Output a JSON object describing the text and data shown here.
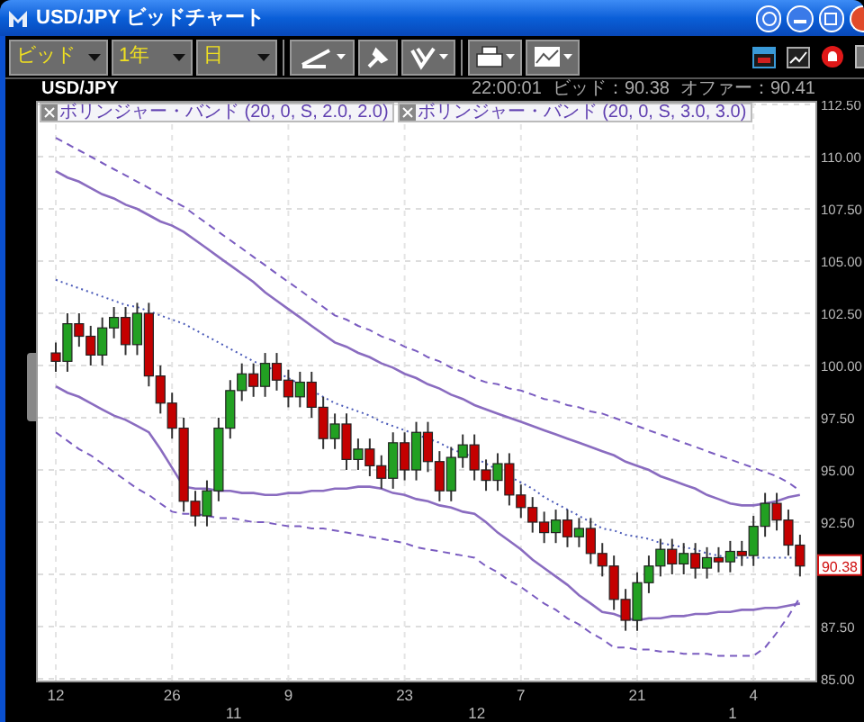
{
  "window": {
    "title": "USD/JPY ビッドチャート"
  },
  "toolbar": {
    "dropdowns": [
      {
        "value": "ビッド"
      },
      {
        "value": "1年"
      },
      {
        "value": "日"
      }
    ]
  },
  "chart": {
    "symbol": "USD/JPY",
    "time": "22:00:01",
    "bid": "ビッド：90.38",
    "offer": "オファー：90.41",
    "legends": [
      {
        "label": "ボリンジャー・バンド (20, 0, S, 2.0, 2.0)"
      },
      {
        "label": "ボリンジャー・バンド (20, 0, S, 3.0, 3.0)"
      }
    ],
    "price_tag": "90.38",
    "chart_data": {
      "type": "candlestick",
      "ylim": [
        85,
        112.5
      ],
      "grid": true,
      "yticks": [
        {
          "value": 85,
          "label": "85.00"
        },
        {
          "value": 87.5,
          "label": "87.50"
        },
        {
          "value": 92.5,
          "label": "92.50"
        },
        {
          "value": 95,
          "label": "95.00"
        },
        {
          "value": 97.5,
          "label": "97.50"
        },
        {
          "value": 100,
          "label": "100.00"
        },
        {
          "value": 102.5,
          "label": "102.50"
        },
        {
          "value": 105,
          "label": "105.00"
        },
        {
          "value": 107.5,
          "label": "107.50"
        },
        {
          "value": 110,
          "label": "110.00"
        },
        {
          "value": 112.5,
          "label": "112.50"
        }
      ],
      "categories": [
        "12",
        null,
        null,
        null,
        null,
        null,
        null,
        null,
        null,
        null,
        "26",
        null,
        null,
        null,
        null,
        null,
        null,
        null,
        null,
        null,
        "9",
        null,
        null,
        null,
        null,
        null,
        null,
        null,
        null,
        null,
        "23",
        null,
        null,
        null,
        null,
        null,
        null,
        null,
        null,
        null,
        "7",
        null,
        null,
        null,
        null,
        null,
        null,
        null,
        null,
        null,
        "21",
        null,
        null,
        null,
        null,
        null,
        null,
        null,
        null,
        null,
        "4",
        null,
        null,
        null,
        null
      ],
      "annotations": [
        "11",
        "12",
        "1"
      ],
      "ohlc": [
        [
          100.6,
          101.1,
          99.7,
          100.2
        ],
        [
          100.2,
          102.5,
          99.7,
          102.0
        ],
        [
          102.0,
          102.5,
          100.9,
          101.4
        ],
        [
          101.4,
          101.9,
          100.0,
          100.5
        ],
        [
          100.5,
          102.3,
          100.0,
          101.8
        ],
        [
          101.8,
          102.8,
          101.3,
          102.3
        ],
        [
          102.3,
          102.8,
          100.5,
          101.0
        ],
        [
          101.0,
          103.0,
          100.5,
          102.5
        ],
        [
          102.5,
          103.0,
          99.0,
          99.5
        ],
        [
          99.5,
          100.0,
          97.7,
          98.2
        ],
        [
          98.2,
          98.7,
          96.5,
          97.0
        ],
        [
          97.0,
          97.5,
          93.0,
          93.5
        ],
        [
          93.5,
          94.0,
          92.3,
          92.8
        ],
        [
          92.8,
          94.5,
          92.3,
          94.0
        ],
        [
          94.0,
          97.5,
          93.5,
          97.0
        ],
        [
          97.0,
          99.3,
          96.5,
          98.8
        ],
        [
          98.8,
          100.1,
          98.3,
          99.6
        ],
        [
          99.6,
          100.1,
          98.5,
          99.0
        ],
        [
          99.0,
          100.6,
          98.5,
          100.1
        ],
        [
          100.1,
          100.6,
          98.8,
          99.3
        ],
        [
          99.3,
          99.8,
          98.0,
          98.5
        ],
        [
          98.5,
          99.7,
          98.0,
          99.2
        ],
        [
          99.2,
          99.7,
          97.5,
          98.0
        ],
        [
          98.0,
          98.5,
          96.0,
          96.5
        ],
        [
          96.5,
          97.7,
          96.0,
          97.2
        ],
        [
          97.2,
          97.7,
          95.0,
          95.5
        ],
        [
          95.5,
          96.5,
          95.0,
          96.0
        ],
        [
          96.0,
          96.5,
          94.7,
          95.2
        ],
        [
          95.2,
          95.7,
          94.1,
          94.6
        ],
        [
          94.6,
          96.8,
          94.1,
          96.3
        ],
        [
          96.3,
          96.8,
          94.5,
          95.0
        ],
        [
          95.0,
          97.3,
          94.5,
          96.8
        ],
        [
          96.8,
          97.3,
          94.9,
          95.4
        ],
        [
          95.4,
          95.9,
          93.5,
          94.0
        ],
        [
          94.0,
          96.1,
          93.5,
          95.6
        ],
        [
          95.6,
          96.7,
          95.1,
          96.2
        ],
        [
          96.2,
          96.7,
          94.5,
          95.0
        ],
        [
          95.0,
          95.5,
          94.0,
          94.5
        ],
        [
          94.5,
          95.8,
          94.0,
          95.3
        ],
        [
          95.3,
          95.8,
          93.3,
          93.8
        ],
        [
          93.8,
          94.3,
          92.7,
          93.2
        ],
        [
          93.2,
          93.7,
          92.0,
          92.5
        ],
        [
          92.5,
          93.0,
          91.5,
          92.0
        ],
        [
          92.0,
          93.1,
          91.5,
          92.6
        ],
        [
          92.6,
          93.1,
          91.3,
          91.8
        ],
        [
          91.8,
          92.7,
          91.3,
          92.2
        ],
        [
          92.2,
          92.7,
          90.5,
          91.0
        ],
        [
          91.0,
          91.5,
          89.9,
          90.4
        ],
        [
          90.4,
          90.9,
          88.3,
          88.8
        ],
        [
          88.8,
          89.3,
          87.3,
          87.8
        ],
        [
          87.8,
          90.1,
          87.3,
          89.6
        ],
        [
          89.6,
          90.9,
          89.1,
          90.4
        ],
        [
          90.4,
          91.7,
          89.9,
          91.2
        ],
        [
          91.2,
          91.7,
          90.0,
          90.5
        ],
        [
          90.5,
          91.5,
          90.0,
          91.0
        ],
        [
          91.0,
          91.5,
          89.8,
          90.3
        ],
        [
          90.3,
          91.3,
          89.8,
          90.8
        ],
        [
          90.8,
          91.3,
          90.1,
          90.6
        ],
        [
          90.6,
          91.6,
          90.1,
          91.1
        ],
        [
          91.1,
          91.6,
          90.4,
          90.9
        ],
        [
          90.9,
          92.8,
          90.4,
          92.3
        ],
        [
          92.3,
          93.9,
          91.8,
          93.4
        ],
        [
          93.4,
          93.9,
          92.1,
          92.6
        ],
        [
          92.6,
          93.1,
          90.9,
          91.4
        ],
        [
          91.4,
          91.9,
          89.9,
          90.4
        ]
      ],
      "series": [
        {
          "type": "line",
          "line_style": "dashed",
          "color": "#7a5cc0",
          "values": [
            110.9,
            110.6,
            110.3,
            110.0,
            109.7,
            109.4,
            109.1,
            108.8,
            108.5,
            108.2,
            107.9,
            107.6,
            107.2,
            106.8,
            106.4,
            106.0,
            105.6,
            105.2,
            104.8,
            104.4,
            104.0,
            103.6,
            103.2,
            102.8,
            102.4,
            102.2,
            101.9,
            101.7,
            101.4,
            101.2,
            100.9,
            100.7,
            100.4,
            100.2,
            99.9,
            99.7,
            99.4,
            99.2,
            99.1,
            98.9,
            98.8,
            98.6,
            98.4,
            98.3,
            98.1,
            98.0,
            97.8,
            97.7,
            97.5,
            97.3,
            97.1,
            96.9,
            96.7,
            96.5,
            96.3,
            96.1,
            95.9,
            95.7,
            95.5,
            95.3,
            95.1,
            94.9,
            94.7,
            94.4,
            94.0
          ]
        },
        {
          "type": "line",
          "line_style": "solid",
          "color": "#8a6cc0",
          "values": [
            109.3,
            109.0,
            108.8,
            108.5,
            108.2,
            108.0,
            107.7,
            107.5,
            107.2,
            106.9,
            106.7,
            106.4,
            106.0,
            105.6,
            105.2,
            104.8,
            104.4,
            104.0,
            103.5,
            103.1,
            102.7,
            102.3,
            101.9,
            101.5,
            101.1,
            100.9,
            100.6,
            100.4,
            100.1,
            99.9,
            99.6,
            99.4,
            99.1,
            98.9,
            98.6,
            98.4,
            98.1,
            97.9,
            97.7,
            97.5,
            97.3,
            97.1,
            96.9,
            96.7,
            96.5,
            96.3,
            96.1,
            95.9,
            95.7,
            95.4,
            95.2,
            95.0,
            94.7,
            94.5,
            94.3,
            94.1,
            93.8,
            93.6,
            93.4,
            93.3,
            93.3,
            93.4,
            93.5,
            93.7,
            93.8
          ]
        },
        {
          "type": "line",
          "line_style": "dotted",
          "color": "#4a5ab8",
          "values": [
            104.1,
            103.9,
            103.7,
            103.5,
            103.3,
            103.1,
            102.9,
            102.8,
            102.6,
            102.4,
            102.2,
            102.0,
            101.7,
            101.4,
            101.1,
            100.8,
            100.5,
            100.2,
            100.0,
            99.7,
            99.4,
            99.1,
            98.8,
            98.5,
            98.2,
            98.0,
            97.8,
            97.6,
            97.3,
            97.1,
            96.9,
            96.7,
            96.5,
            96.3,
            96.0,
            95.8,
            95.6,
            95.3,
            95.0,
            94.7,
            94.4,
            94.1,
            93.7,
            93.4,
            93.1,
            92.8,
            92.5,
            92.2,
            92.1,
            91.9,
            91.8,
            91.7,
            91.5,
            91.4,
            91.3,
            91.2,
            91.0,
            90.9,
            90.8,
            90.8,
            90.8,
            90.8,
            90.8,
            90.8,
            90.8
          ]
        },
        {
          "type": "line",
          "line_style": "solid",
          "color": "#8a6cc0",
          "values": [
            99.0,
            98.7,
            98.5,
            98.2,
            97.9,
            97.6,
            97.4,
            97.1,
            96.8,
            96.0,
            95.1,
            94.2,
            94.1,
            94.1,
            94.0,
            94.0,
            93.9,
            93.9,
            93.8,
            93.8,
            93.9,
            93.9,
            94.0,
            94.0,
            94.1,
            94.1,
            94.2,
            94.2,
            94.1,
            93.9,
            93.8,
            93.6,
            93.5,
            93.3,
            93.2,
            93.0,
            92.9,
            92.5,
            92.0,
            91.6,
            91.2,
            90.7,
            90.3,
            89.9,
            89.5,
            89.0,
            88.6,
            88.2,
            88.1,
            87.9,
            87.8,
            87.9,
            87.9,
            88.0,
            88.0,
            88.1,
            88.1,
            88.2,
            88.2,
            88.3,
            88.3,
            88.4,
            88.4,
            88.5,
            88.6
          ]
        },
        {
          "type": "line",
          "line_style": "dashed",
          "color": "#7a5cc0",
          "values": [
            96.8,
            96.4,
            96.0,
            95.7,
            95.3,
            94.9,
            94.5,
            94.1,
            93.8,
            93.4,
            93.0,
            92.9,
            92.9,
            92.8,
            92.7,
            92.7,
            92.6,
            92.5,
            92.5,
            92.4,
            92.3,
            92.3,
            92.2,
            92.2,
            92.1,
            92.0,
            91.9,
            91.8,
            91.7,
            91.6,
            91.5,
            91.3,
            91.2,
            91.1,
            91.0,
            90.9,
            90.8,
            90.4,
            90.1,
            89.7,
            89.4,
            89.0,
            88.6,
            88.3,
            87.9,
            87.6,
            87.2,
            86.9,
            86.5,
            86.5,
            86.4,
            86.4,
            86.3,
            86.3,
            86.2,
            86.2,
            86.2,
            86.1,
            86.1,
            86.1,
            86.1,
            86.5,
            87.2,
            88.0,
            88.9
          ]
        }
      ]
    }
  }
}
